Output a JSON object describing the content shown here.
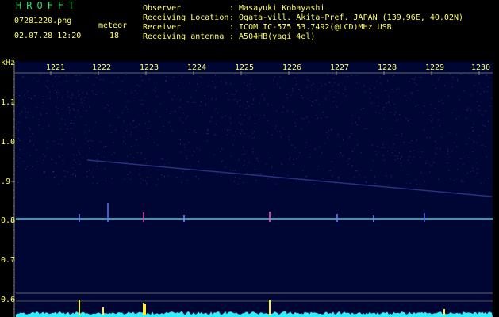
{
  "app": {
    "title": "HROFFT"
  },
  "file": {
    "name": "07281220.png",
    "datetime": "02.07.28 12:20"
  },
  "meteor": {
    "label": "meteor",
    "count": "18"
  },
  "meta": [
    {
      "key": "Observer",
      "value": ": Masayuki Kobayashi"
    },
    {
      "key": "Receiving Location",
      "value": ": Ogata-vill. Akita-Pref. JAPAN (139.96E, 40.02N)"
    },
    {
      "key": "Receiver",
      "value": ": ICOM IC-575 53.7492(@LCD)MHz USB"
    },
    {
      "key": "Receiving antenna",
      "value": ": A504HB(yagi 4el)"
    }
  ],
  "axis": {
    "y_unit": "kHz",
    "y_ticks": [
      "1.1",
      "1.0",
      ".9",
      "0.8",
      "0.7",
      "0.6"
    ],
    "x_ticks": [
      "1221",
      "1222",
      "1223",
      "1224",
      "1225",
      "1226",
      "1227",
      "1228",
      "1229",
      "1230"
    ]
  },
  "colors": {
    "background": "#000000",
    "plot": "#000633",
    "trace": "#44ccdd",
    "text": "#ffff66",
    "title": "#33dd66"
  }
}
